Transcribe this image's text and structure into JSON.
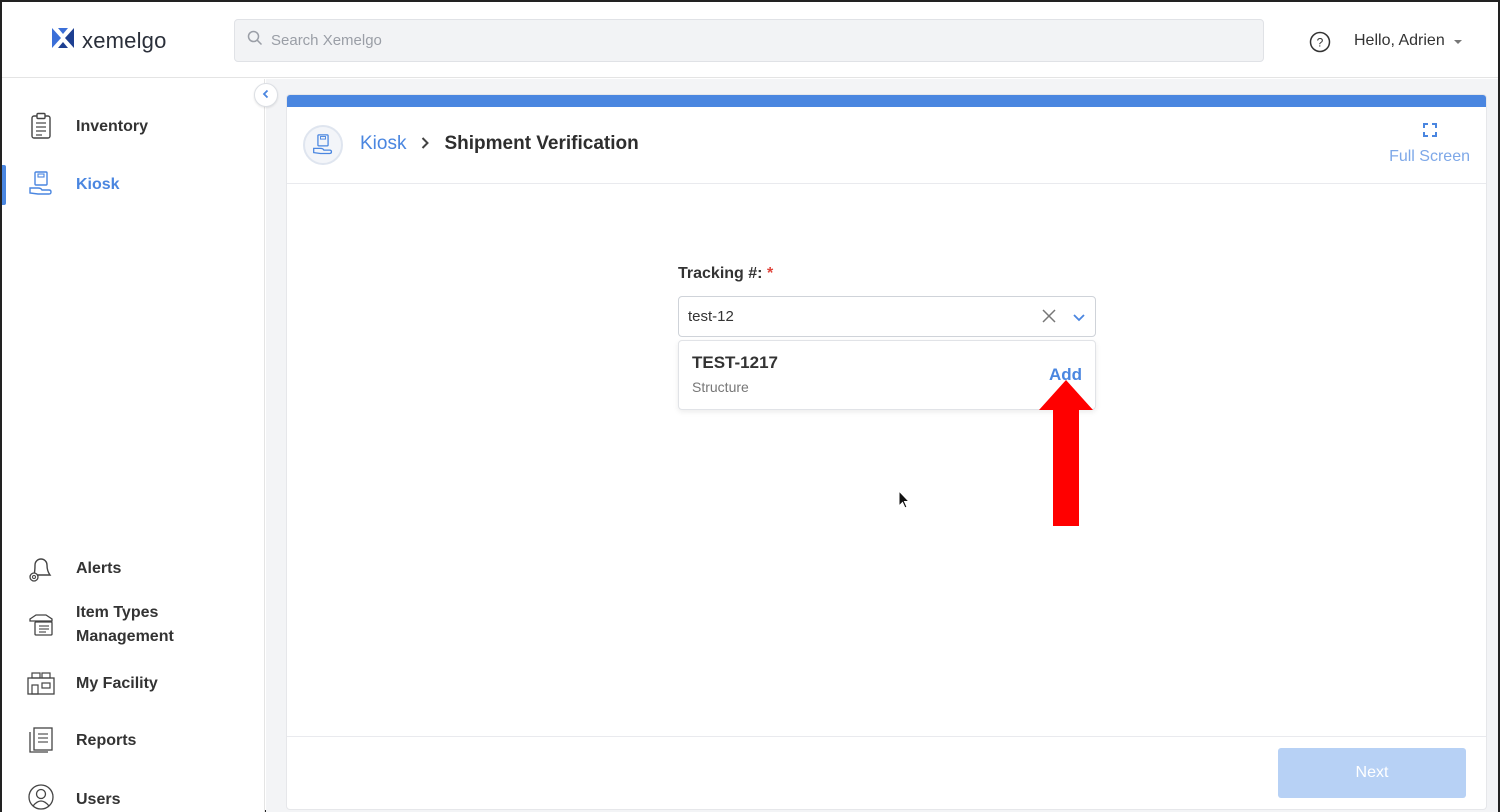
{
  "header": {
    "logo_text": "xemelgo",
    "search_placeholder": "Search Xemelgo",
    "greeting": "Hello, Adrien"
  },
  "sidebar": {
    "items": [
      {
        "label": "Inventory",
        "icon": "clipboard-icon"
      },
      {
        "label": "Kiosk",
        "icon": "kiosk-icon",
        "active": true
      },
      {
        "label": "Alerts",
        "icon": "bell-icon"
      },
      {
        "label": "Item Types",
        "label2": "Management",
        "icon": "item-types-icon"
      },
      {
        "label": "My Facility",
        "icon": "facility-icon"
      },
      {
        "label": "Reports",
        "icon": "reports-icon"
      },
      {
        "label": "Users",
        "icon": "user-icon"
      }
    ]
  },
  "breadcrumb": {
    "parent": "Kiosk",
    "separator": ">",
    "current": "Shipment Verification"
  },
  "fullscreen_label": "Full Screen",
  "form": {
    "tracking_label": "Tracking #:",
    "required_mark": "*",
    "tracking_value": "test-12"
  },
  "dropdown": {
    "option_title": "TEST-1217",
    "option_subtitle": "Structure",
    "add_label": "Add"
  },
  "footer": {
    "next_label": "Next"
  },
  "colors": {
    "accent": "#4a86e0",
    "arrow": "#ff0000",
    "next_disabled": "#b7d1f5"
  }
}
